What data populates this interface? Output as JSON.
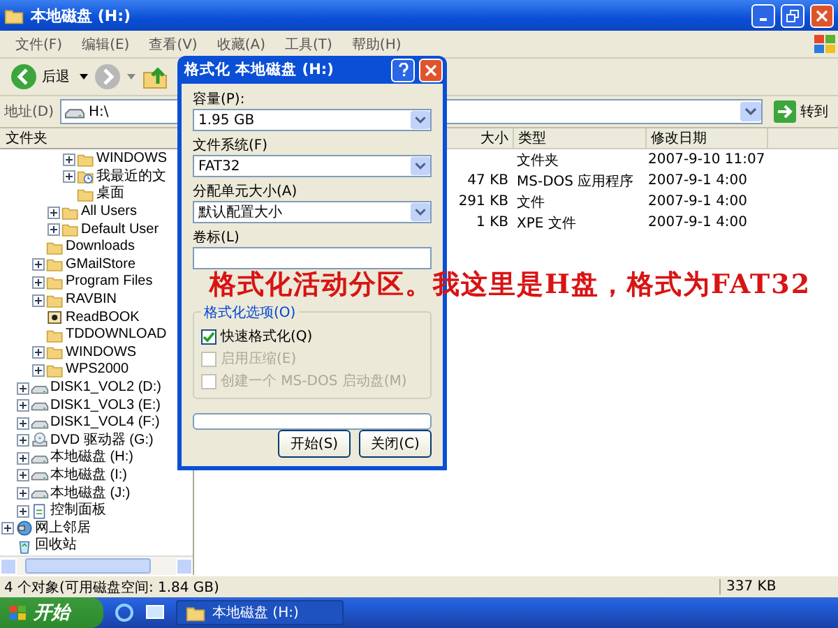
{
  "window": {
    "title": "本地磁盘 (H:)"
  },
  "menu": [
    "文件(F)",
    "编辑(E)",
    "查看(V)",
    "收藏(A)",
    "工具(T)",
    "帮助(H)"
  ],
  "toolbar": {
    "back": "后退"
  },
  "address": {
    "label": "地址(D)",
    "value": "H:\\",
    "go": "转到"
  },
  "folders_pane": {
    "title": "文件夹",
    "tree": [
      {
        "children": [
          {
            "children": [
              {
                "children": [
                  {
                    "children": [
                      {
                        "label": "WINDOWS",
                        "kind": "folder",
                        "expandable": true
                      },
                      {
                        "label": "我最近的文",
                        "kind": "recent",
                        "expandable": true
                      },
                      {
                        "label": "桌面",
                        "kind": "folder",
                        "expandable": false
                      }
                    ]
                  },
                  {
                    "label": "All Users",
                    "kind": "folder",
                    "expandable": true
                  },
                  {
                    "label": "Default User",
                    "kind": "folder",
                    "expandable": true
                  }
                ]
              },
              {
                "label": "Downloads",
                "kind": "folder",
                "expandable": false
              },
              {
                "label": "GMailStore",
                "kind": "folder",
                "expandable": true
              },
              {
                "label": "Program Files",
                "kind": "folder",
                "expandable": true
              },
              {
                "label": "RAVBIN",
                "kind": "folder",
                "expandable": true
              },
              {
                "label": "ReadBOOK",
                "kind": "book",
                "expandable": false
              },
              {
                "label": "TDDOWNLOAD",
                "kind": "folder",
                "expandable": false
              },
              {
                "label": "WINDOWS",
                "kind": "folder",
                "expandable": true
              },
              {
                "label": "WPS2000",
                "kind": "folder",
                "expandable": true
              }
            ]
          },
          {
            "label": "DISK1_VOL2 (D:)",
            "kind": "drive",
            "expandable": true
          },
          {
            "label": "DISK1_VOL3 (E:)",
            "kind": "drive",
            "expandable": true
          },
          {
            "label": "DISK1_VOL4 (F:)",
            "kind": "drive",
            "expandable": true
          },
          {
            "label": "DVD 驱动器 (G:)",
            "kind": "dvd",
            "expandable": true
          },
          {
            "label": "本地磁盘 (H:)",
            "kind": "drive",
            "expandable": true
          },
          {
            "label": "本地磁盘 (I:)",
            "kind": "drive",
            "expandable": true
          },
          {
            "label": "本地磁盘 (J:)",
            "kind": "drive",
            "expandable": true
          },
          {
            "label": "控制面板",
            "kind": "control",
            "expandable": true
          }
        ]
      },
      {
        "label": "网上邻居",
        "kind": "network",
        "expandable": true
      },
      {
        "label": "回收站",
        "kind": "recycle",
        "expandable": false
      }
    ]
  },
  "file_list": {
    "columns": [
      "大小",
      "类型",
      "修改日期"
    ],
    "rows": [
      {
        "type": "文件夹",
        "modified": "2007-9-10 11:07"
      },
      {
        "size": "47 KB",
        "type": "MS-DOS 应用程序",
        "modified": "2007-9-1 4:00"
      },
      {
        "size": "291 KB",
        "type": "文件",
        "modified": "2007-9-1 4:00"
      },
      {
        "size": "1 KB",
        "type": "XPE 文件",
        "modified": "2007-9-1 4:00"
      }
    ]
  },
  "status_bar": {
    "objects": "4 个对象(可用磁盘空间: 1.84 GB)",
    "size": "337 KB"
  },
  "taskbar": {
    "start": "开始",
    "tasks": [
      "本地磁盘 (H:)"
    ]
  },
  "dialog": {
    "title": "格式化 本地磁盘 (H:)",
    "fields": [
      {
        "label": "容量(P):",
        "value": "1.95 GB",
        "kind": "select"
      },
      {
        "label": "文件系统(F)",
        "value": "FAT32",
        "kind": "select"
      },
      {
        "label": "分配单元大小(A)",
        "value": "默认配置大小",
        "kind": "select"
      },
      {
        "label": "卷标(L)",
        "kind": "text"
      }
    ],
    "options_title": "格式化选项(O)",
    "options": [
      {
        "label": "快速格式化(Q)",
        "checked": true,
        "disabled": false
      },
      {
        "label": "启用压缩(E)",
        "checked": false,
        "disabled": true
      },
      {
        "label": "创建一个 MS-DOS 启动盘(M)",
        "checked": false,
        "disabled": true
      }
    ],
    "progress": {
      "level": 0
    },
    "buttons": [
      "开始(S)",
      "关闭(C)"
    ]
  },
  "annotation": "格式化活动分区。我这里是H盘，格式为FAT32"
}
